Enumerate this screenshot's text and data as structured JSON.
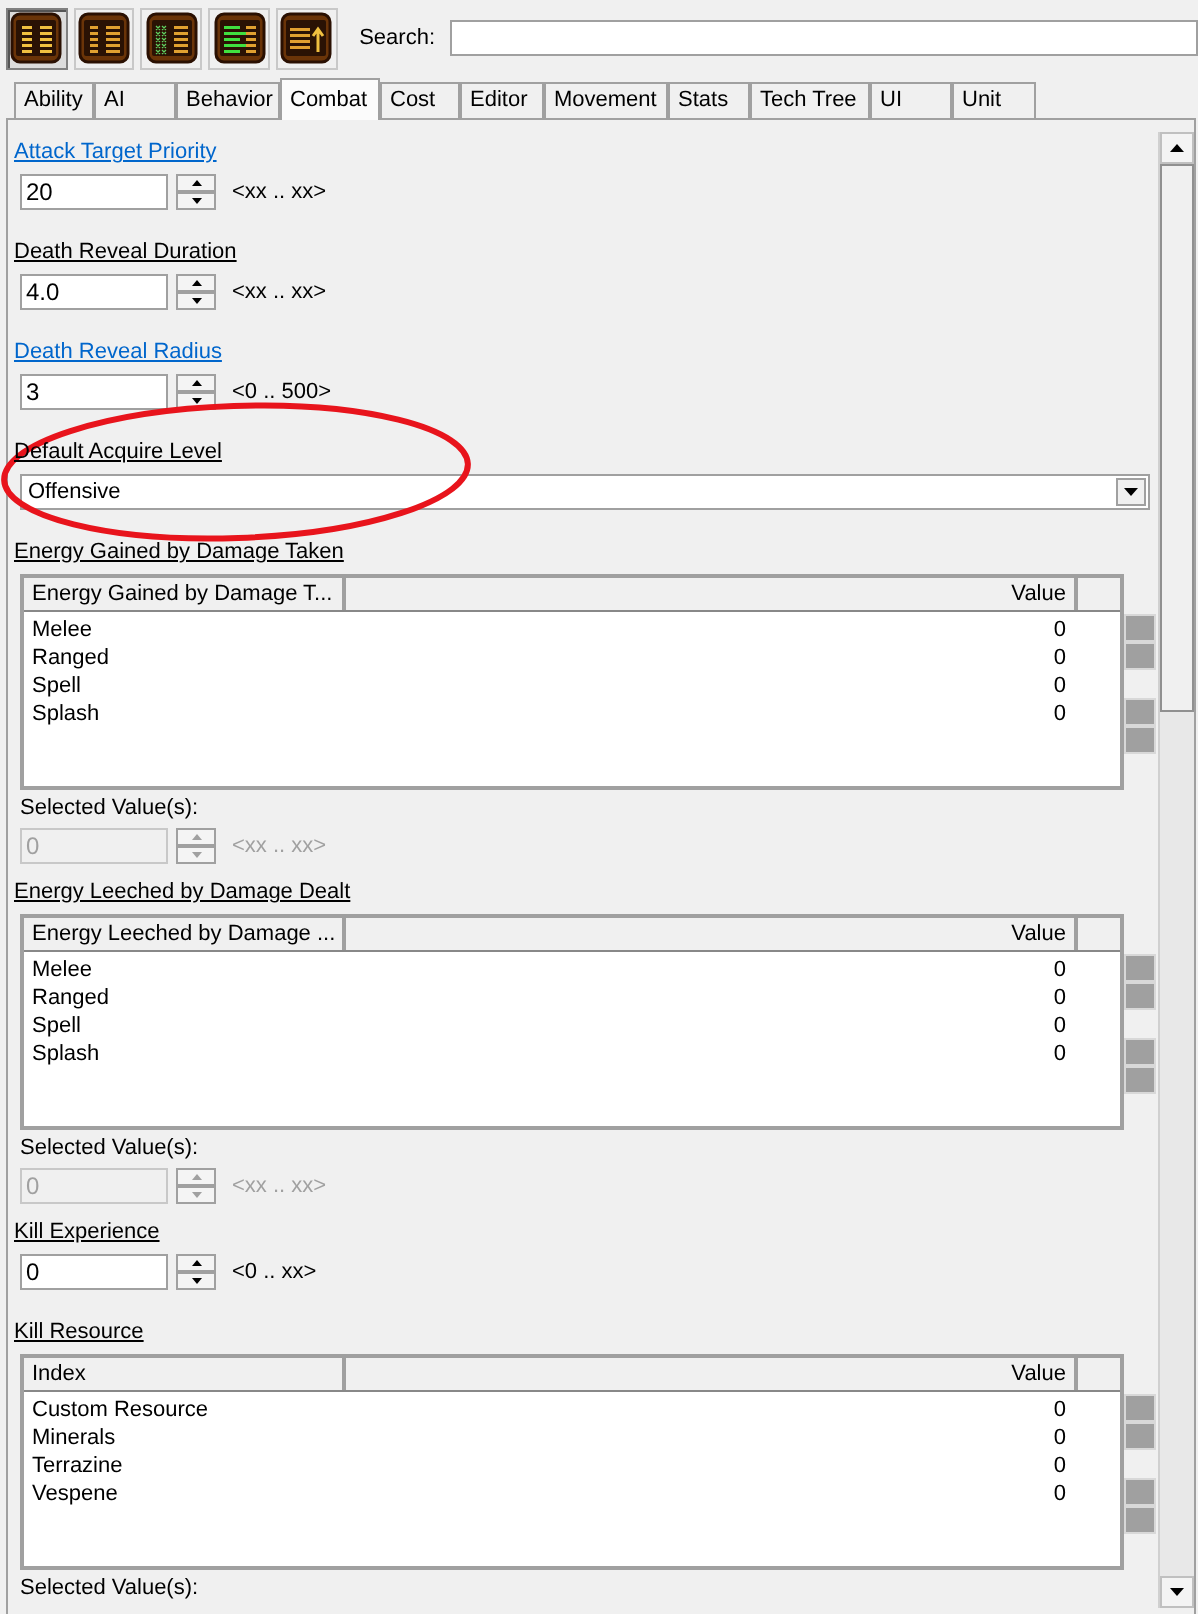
{
  "toolbar": {
    "buttons": [
      {
        "selected": true
      },
      {
        "selected": false
      },
      {
        "selected": false
      },
      {
        "selected": false
      },
      {
        "selected": false
      }
    ],
    "search_label": "Search:"
  },
  "tabs": [
    {
      "label": "Ability",
      "selected": false
    },
    {
      "label": "AI",
      "selected": false
    },
    {
      "label": "Behavior",
      "selected": false
    },
    {
      "label": "Combat",
      "selected": true
    },
    {
      "label": "Cost",
      "selected": false
    },
    {
      "label": "Editor",
      "selected": false
    },
    {
      "label": "Movement",
      "selected": false
    },
    {
      "label": "Stats",
      "selected": false
    },
    {
      "label": "Tech Tree",
      "selected": false
    },
    {
      "label": "UI",
      "selected": false
    },
    {
      "label": "Unit",
      "selected": false
    }
  ],
  "fields": [
    {
      "kind": "spinner",
      "label": "Attack Target Priority",
      "linked": true,
      "value": "20",
      "range": "<xx .. xx>",
      "disabled": false
    },
    {
      "kind": "spinner",
      "label": "Death Reveal Duration",
      "linked": false,
      "value": "4.0",
      "range": "<xx .. xx>",
      "disabled": false
    },
    {
      "kind": "spinner",
      "label": "Death Reveal Radius",
      "linked": true,
      "value": "3",
      "range": "<0 .. 500>",
      "disabled": false
    },
    {
      "kind": "dropdown",
      "label": "Default Acquire Level",
      "linked": false,
      "value": "Offensive"
    },
    {
      "kind": "table",
      "label": "Energy Gained by Damage Taken",
      "linked": false,
      "columns": [
        "Energy Gained by Damage T...",
        "Value"
      ],
      "rows": [
        {
          "name": "Melee",
          "value": "0"
        },
        {
          "name": "Ranged",
          "value": "0"
        },
        {
          "name": "Spell",
          "value": "0"
        },
        {
          "name": "Splash",
          "value": "0"
        }
      ],
      "selected_label": "Selected Value(s):",
      "selected_spinner": {
        "value": "0",
        "range": "<xx .. xx>",
        "disabled": true
      }
    },
    {
      "kind": "table",
      "label": "Energy Leeched by Damage Dealt",
      "linked": false,
      "columns": [
        "Energy Leeched by Damage ...",
        "Value"
      ],
      "rows": [
        {
          "name": "Melee",
          "value": "0"
        },
        {
          "name": "Ranged",
          "value": "0"
        },
        {
          "name": "Spell",
          "value": "0"
        },
        {
          "name": "Splash",
          "value": "0"
        }
      ],
      "selected_label": "Selected Value(s):",
      "selected_spinner": {
        "value": "0",
        "range": "<xx .. xx>",
        "disabled": true
      }
    },
    {
      "kind": "spinner",
      "label": "Kill Experience",
      "linked": false,
      "value": "0",
      "range": "<0 .. xx>",
      "disabled": false
    },
    {
      "kind": "table",
      "label": "Kill Resource",
      "linked": false,
      "columns": [
        "Index",
        "Value"
      ],
      "rows": [
        {
          "name": "Custom Resource",
          "value": "0"
        },
        {
          "name": "Minerals",
          "value": "0"
        },
        {
          "name": "Terrazine",
          "value": "0"
        },
        {
          "name": "Vespene",
          "value": "0"
        }
      ],
      "selected_label": "Selected Value(s):"
    }
  ]
}
